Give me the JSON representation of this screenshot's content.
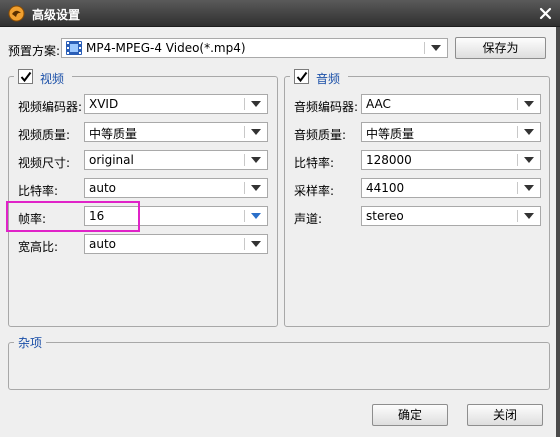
{
  "window": {
    "title": "高级设置",
    "close": "✕"
  },
  "preset": {
    "label": "预置方案:",
    "value": "MP4-MPEG-4 Video(*.mp4)",
    "save_as": "保存为"
  },
  "video": {
    "title": "视频",
    "checked": true,
    "fields": [
      {
        "label": "视频编码器:",
        "value": "XVID"
      },
      {
        "label": "视频质量:",
        "value": "中等质量"
      },
      {
        "label": "视频尺寸:",
        "value": "original"
      },
      {
        "label": "比特率:",
        "value": "auto"
      },
      {
        "label": "帧率:",
        "value": "16"
      },
      {
        "label": "宽高比:",
        "value": "auto"
      }
    ]
  },
  "audio": {
    "title": "音频",
    "checked": true,
    "fields": [
      {
        "label": "音频编码器:",
        "value": "AAC"
      },
      {
        "label": "音频质量:",
        "value": "中等质量"
      },
      {
        "label": "比特率:",
        "value": "128000"
      },
      {
        "label": "采样率:",
        "value": "44100"
      },
      {
        "label": "声道:",
        "value": "stereo"
      }
    ]
  },
  "misc": {
    "title": "杂项"
  },
  "buttons": {
    "ok": "确定",
    "close": "关闭"
  },
  "colors": {
    "accent": "#1a4fa8",
    "highlight": "#e023c8",
    "titlebar": "#3a3a3a"
  },
  "icons": {
    "app": "app-logo-icon",
    "preset": "film-strip-icon",
    "close": "close-icon",
    "dropdown": "chevron-down-icon",
    "check": "checkmark-icon"
  }
}
